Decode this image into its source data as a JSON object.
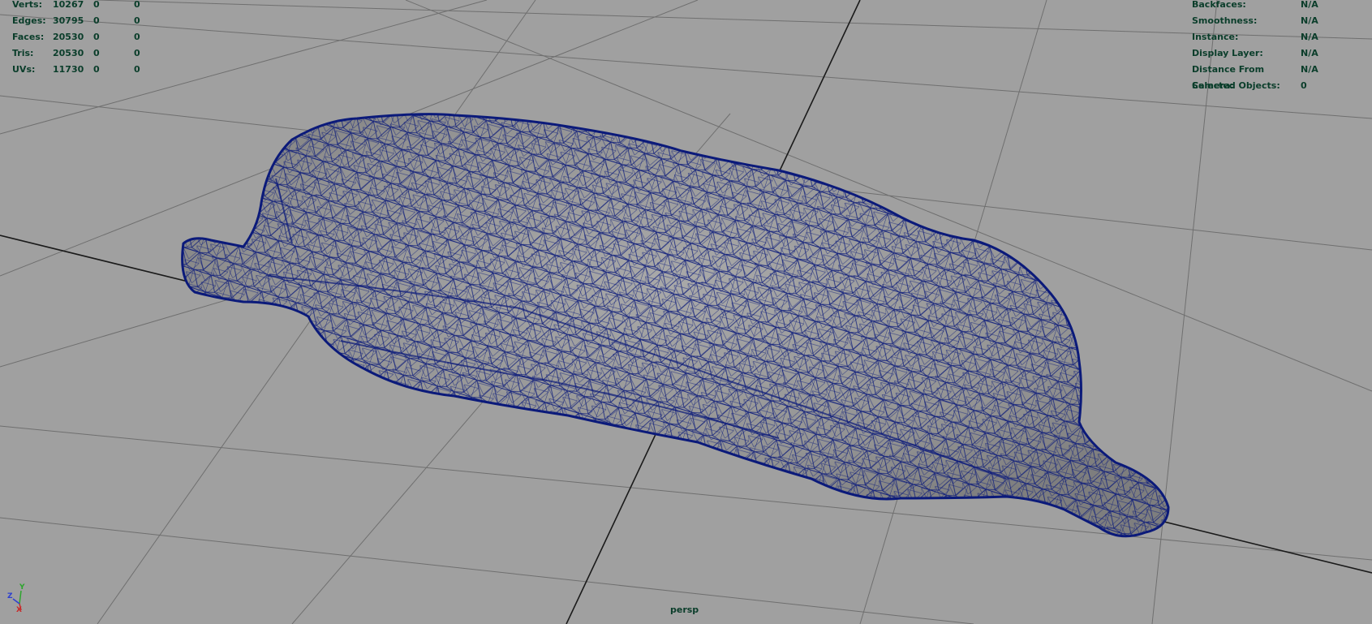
{
  "viewport": {
    "camera": "persp"
  },
  "poly_count": {
    "rows": [
      {
        "label": "Verts:",
        "v1": "10267",
        "v2": "0",
        "v3": "0"
      },
      {
        "label": "Edges:",
        "v1": "30795",
        "v2": "0",
        "v3": "0"
      },
      {
        "label": "Faces:",
        "v1": "20530",
        "v2": "0",
        "v3": "0"
      },
      {
        "label": "Tris:",
        "v1": "20530",
        "v2": "0",
        "v3": "0"
      },
      {
        "label": "UVs:",
        "v1": "11730",
        "v2": "0",
        "v3": "0"
      }
    ]
  },
  "object_info": {
    "rows": [
      {
        "label": "Backfaces:",
        "value": "N/A"
      },
      {
        "label": "Smoothness:",
        "value": "N/A"
      },
      {
        "label": "Instance:",
        "value": "N/A"
      },
      {
        "label": "Display Layer:",
        "value": "N/A"
      },
      {
        "label": "Distance From Camera:",
        "value": "N/A"
      },
      {
        "label": "Selected Objects:",
        "value": "0"
      }
    ]
  },
  "axis_gizmo": {
    "x": "X",
    "y": "Y",
    "z": "Z"
  },
  "colors": {
    "background": "#a0a0a0",
    "grid": "#6f6f6f",
    "axis": "#1a1a1a",
    "wireframe": "#0b1a7a",
    "hud_text": "#0a3d2a"
  }
}
